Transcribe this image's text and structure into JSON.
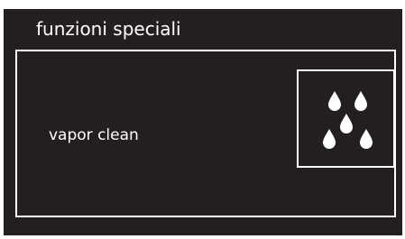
{
  "header": {
    "title": "funzioni speciali"
  },
  "option": {
    "label": "vapor clean",
    "icon": "water-drops-icon"
  },
  "colors": {
    "background": "#231f20",
    "foreground": "#ffffff"
  }
}
